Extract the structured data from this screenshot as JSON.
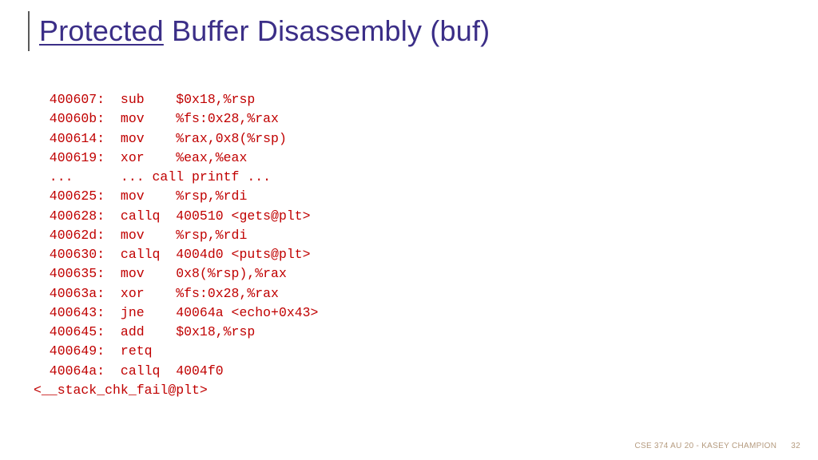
{
  "title": {
    "underlined": "Protected",
    "rest": " Buffer Disassembly (buf)"
  },
  "code": {
    "lines": [
      "  400607:  sub    $0x18,%rsp",
      "  40060b:  mov    %fs:0x28,%rax",
      "  400614:  mov    %rax,0x8(%rsp)",
      "  400619:  xor    %eax,%eax",
      "  ...      ... call printf ...",
      "  400625:  mov    %rsp,%rdi",
      "  400628:  callq  400510 <gets@plt>",
      "  40062d:  mov    %rsp,%rdi",
      "  400630:  callq  4004d0 <puts@plt>",
      "  400635:  mov    0x8(%rsp),%rax",
      "  40063a:  xor    %fs:0x28,%rax",
      "  400643:  jne    40064a <echo+0x43>",
      "  400645:  add    $0x18,%rsp",
      "  400649:  retq",
      "  40064a:  callq  4004f0 ",
      "<__stack_chk_fail@plt>"
    ]
  },
  "footer": {
    "text": "CSE 374 AU 20 - KASEY CHAMPION",
    "page": "32"
  }
}
